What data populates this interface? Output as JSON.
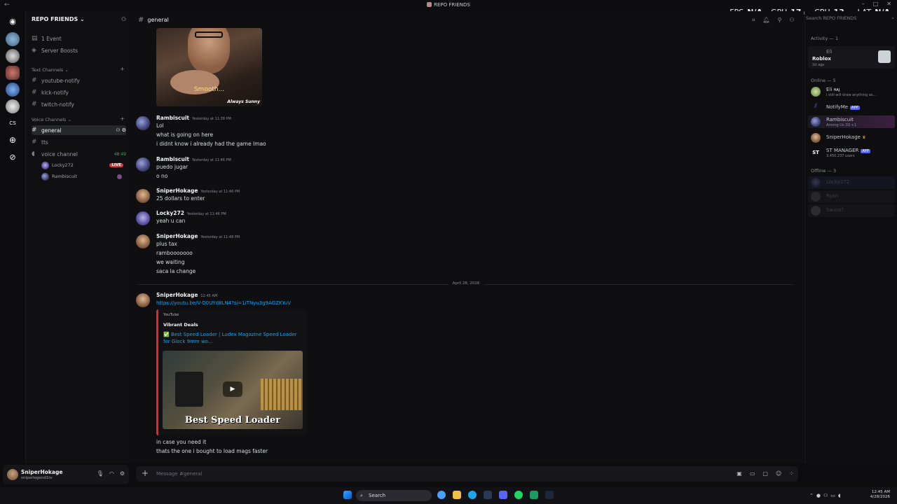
{
  "window": {
    "title": "REPO FRIENDS"
  },
  "stats": {
    "fps_label": "FPS",
    "fps": "N/A",
    "gpu_label": "GPU",
    "gpu": "17",
    "cpu_label": "CPU",
    "cpu": "13",
    "lat_label": "LAT",
    "lat": "N/A",
    "pct": "%"
  },
  "rail": {
    "cs_label": "CS"
  },
  "sidebar": {
    "server_name": "REPO FRIENDS",
    "event": "1 Event",
    "boosts": "Server Boosts",
    "text_category": "Text Channels",
    "text_channels": [
      "youtube-notify",
      "kick-notify",
      "twitch-notify"
    ],
    "voice_category": "Voice Channels",
    "active_channel": "general",
    "tts_channel": "tts",
    "voice_channel": "voice channel",
    "voice_timer": "48:49",
    "voice_users": [
      {
        "name": "Locky272",
        "live": "LIVE"
      },
      {
        "name": "Rambiscuit"
      }
    ]
  },
  "user": {
    "name": "SniperHokage",
    "sub": "sniperlegend1tv"
  },
  "channel": {
    "name": "general"
  },
  "gif": {
    "caption": "Smooth...",
    "logo": "Always Sunny"
  },
  "messages": [
    {
      "author": "Rambiscuit",
      "time": "Yesterday at 11:38 PM",
      "lines": [
        "Lol",
        "what is going on here",
        "i didnt know i already had the game lmao"
      ]
    },
    {
      "author": "Rambiscuit",
      "time": "Yesterday at 11:46 PM",
      "lines": [
        "puedo jugar",
        "o no"
      ]
    },
    {
      "author": "SniperHokage",
      "time": "Yesterday at 11:46 PM",
      "lines": [
        "25 dollars to enter"
      ]
    },
    {
      "author": "Locky272",
      "time": "Yesterday at 11:46 PM",
      "lines": [
        "yeah u can"
      ]
    },
    {
      "author": "SniperHokage",
      "time": "Yesterday at 11:48 PM",
      "lines": [
        "plus tax",
        "rambooooooo",
        "we waiting",
        "saca la change"
      ]
    }
  ],
  "date_divider": "April 28, 2026",
  "last_message": {
    "author": "SniperHokage",
    "time": "12:45 AM",
    "link": "https://youtu.be/V-D0UYd8LN4?si=1iTNyu3g9AGZKYuV",
    "after": [
      "in case you need it",
      "thats the one i bought to load mags faster"
    ]
  },
  "embed": {
    "provider": "YouTube",
    "author": "Vibrant Deals",
    "title": "✅ Best Speed Loader | Ludex Magazine Speed Loader for Glock 9mm wo...",
    "thumb_caption": "Best Speed Loader"
  },
  "composer": {
    "placeholder": "Message #general"
  },
  "members": {
    "search_placeholder": "Search REPO FRIENDS",
    "activity_header": "Activity — 1",
    "activity": {
      "name": "Eli",
      "game": "Roblox",
      "ago": "2d ago"
    },
    "online_header": "Online — 5",
    "online": [
      {
        "name": "Eli",
        "status": "i still will draw anything as...",
        "tag": "HAJ"
      },
      {
        "name": "NotifyMe",
        "app": "APP"
      },
      {
        "name": "Rambiscuit",
        "status": "Among Us 3D +1"
      },
      {
        "name": "SniperHokage"
      },
      {
        "name": "ST MANAGER",
        "app": "APP",
        "status": "3,450,237 users"
      }
    ],
    "offline_header": "Offline — 3",
    "offline": [
      "Locky272",
      "Ryan",
      "Sauce?"
    ]
  },
  "taskbar": {
    "search": "Search",
    "time": "12:45 AM",
    "date": "4/28/2026"
  },
  "colors": {
    "accent": "#5865f2",
    "link": "#00a8fc",
    "live": "#da373c",
    "embed_bar": "#e7262b"
  }
}
